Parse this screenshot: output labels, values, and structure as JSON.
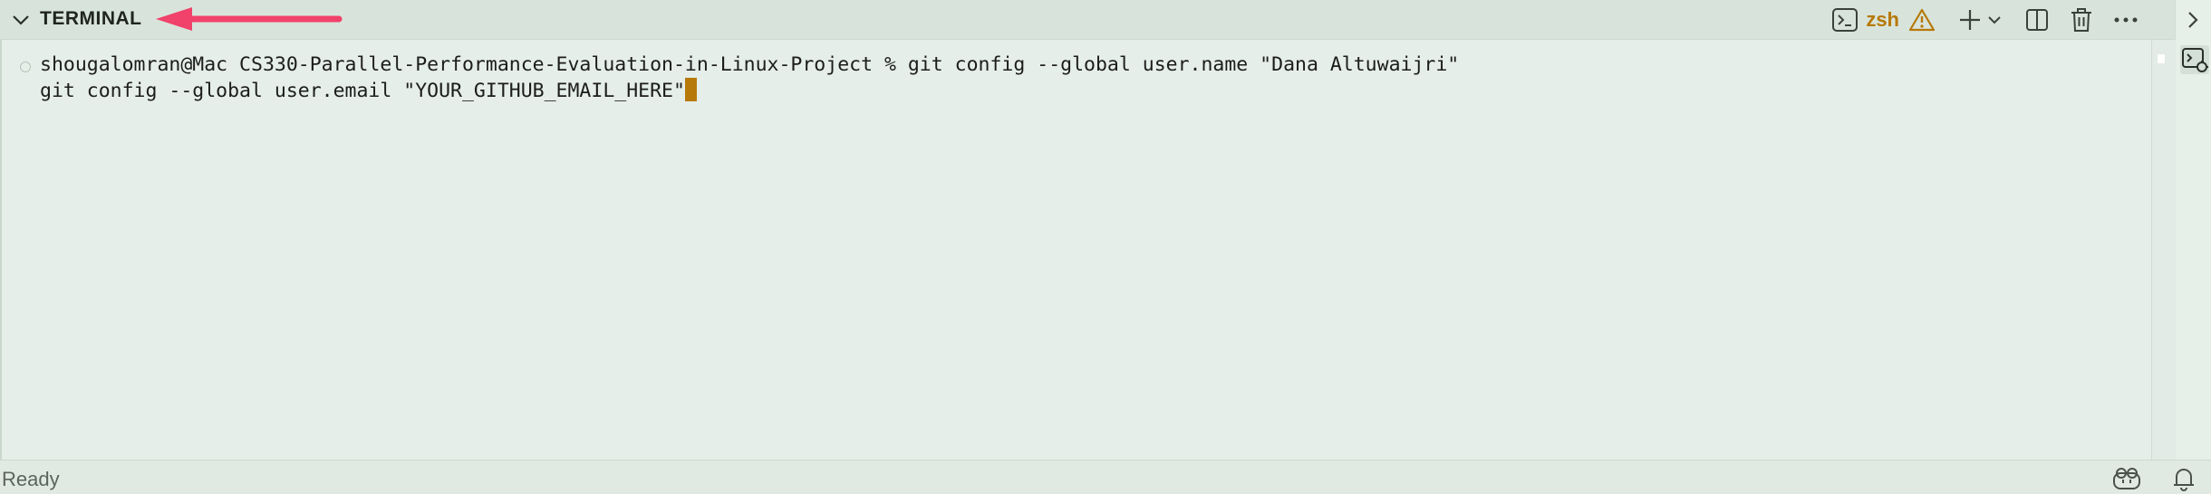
{
  "panel": {
    "title": "TERMINAL"
  },
  "toolbar": {
    "shell_label": "zsh",
    "icons": [
      "terminal-icon",
      "warning-icon",
      "plus-icon",
      "chevron-down-icon",
      "split-icon",
      "trash-icon",
      "more-icon",
      "chevron-right-icon"
    ],
    "accent_color": "#b7790a"
  },
  "terminal": {
    "lines": [
      "shougalomran@Mac CS330-Parallel-Performance-Evaluation-in-Linux-Project % git config --global user.name \"Dana Altuwaijri\"",
      "git config --global user.email \"YOUR_GITHUB_EMAIL_HERE\""
    ]
  },
  "status": {
    "text": "Ready"
  },
  "annotation": {
    "arrow_color": "#f0426a"
  }
}
